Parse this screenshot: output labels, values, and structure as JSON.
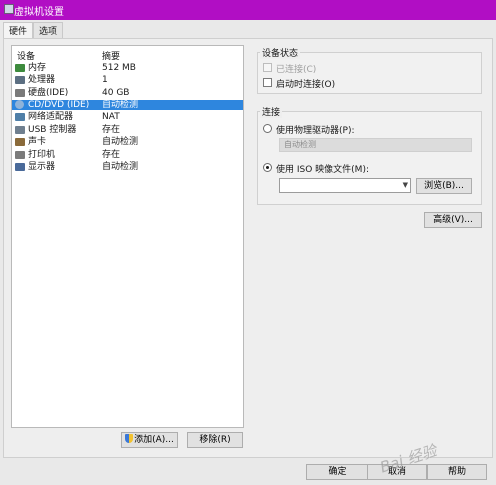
{
  "window": {
    "title": "虚拟机设置"
  },
  "tabs": [
    {
      "label": "硬件",
      "active": true
    },
    {
      "label": "选项",
      "active": false
    }
  ],
  "device_list": {
    "headers": {
      "device": "设备",
      "summary": "摘要"
    },
    "items": [
      {
        "name": "内存",
        "summary": "512 MB",
        "icon": "memory-icon",
        "color": "#3d8b3d"
      },
      {
        "name": "处理器",
        "summary": "1",
        "icon": "cpu-icon",
        "color": "#5c6f82"
      },
      {
        "name": "硬盘(IDE)",
        "summary": "40 GB",
        "icon": "hard-disk-icon",
        "color": "#7a7a7a"
      },
      {
        "name": "CD/DVD (IDE)",
        "summary": "自动检测",
        "icon": "cd-dvd-icon",
        "color": "#8fb3d9",
        "selected": true
      },
      {
        "name": "网络适配器",
        "summary": "NAT",
        "icon": "network-adapter-icon",
        "color": "#4f7fa8"
      },
      {
        "name": "USB 控制器",
        "summary": "存在",
        "icon": "usb-controller-icon",
        "color": "#6f7f8f"
      },
      {
        "name": "声卡",
        "summary": "自动检测",
        "icon": "sound-card-icon",
        "color": "#8a6a3a"
      },
      {
        "name": "打印机",
        "summary": "存在",
        "icon": "printer-icon",
        "color": "#7b7b7b"
      },
      {
        "name": "显示器",
        "summary": "自动检测",
        "icon": "display-icon",
        "color": "#4a6a9a"
      }
    ]
  },
  "buttons": {
    "add": "添加(A)...",
    "remove": "移除(R)",
    "browse": "浏览(B)...",
    "advanced": "高级(V)...",
    "ok": "确定",
    "cancel": "取消",
    "help": "帮助"
  },
  "device_status": {
    "title": "设备状态",
    "connected": {
      "label": "已连接(C)",
      "checked": false,
      "disabled": true
    },
    "connect_at_power_on": {
      "label": "启动时连接(O)",
      "checked": false
    }
  },
  "connection": {
    "title": "连接",
    "physical_drive": {
      "label": "使用物理驱动器(P):",
      "selected": false,
      "value": "自动检测"
    },
    "iso_image": {
      "label": "使用 ISO 映像文件(M):",
      "selected": true,
      "value": ""
    }
  },
  "watermark": "Bai 经验",
  "colors": {
    "titlebar": "#b10ec4",
    "selection": "#2e86de"
  }
}
